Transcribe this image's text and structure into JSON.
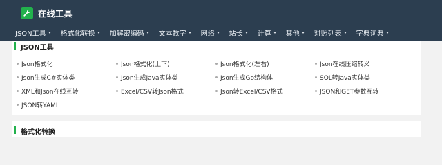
{
  "brand": {
    "name": "在线工具",
    "icon": "wrench-icon"
  },
  "nav": {
    "items": [
      {
        "label": "JSON工具"
      },
      {
        "label": "格式化转换"
      },
      {
        "label": "加解密编码"
      },
      {
        "label": "文本数字"
      },
      {
        "label": "网络"
      },
      {
        "label": "站长"
      },
      {
        "label": "计算"
      },
      {
        "label": "其他"
      },
      {
        "label": "对照列表"
      },
      {
        "label": "字典词典"
      }
    ]
  },
  "sections": [
    {
      "title": "JSON工具",
      "links": [
        "Json格式化",
        "Json格式化(上下)",
        "Json格式化(左右)",
        "Json在线压缩转义",
        "Json生成C#实体类",
        "Json生成Java实体类",
        "Json生成Go结构体",
        "SQL转Java实体类",
        "XML和Json在线互转",
        "Excel/CSV转Json格式",
        "Json转Excel/CSV格式",
        "JSON和GET参数互转",
        "JSON转YAML"
      ]
    },
    {
      "title": "格式化转换"
    }
  ],
  "colors": {
    "topbar": "#2c3e50",
    "accent": "#22b14c",
    "background": "#f2f2f2"
  }
}
